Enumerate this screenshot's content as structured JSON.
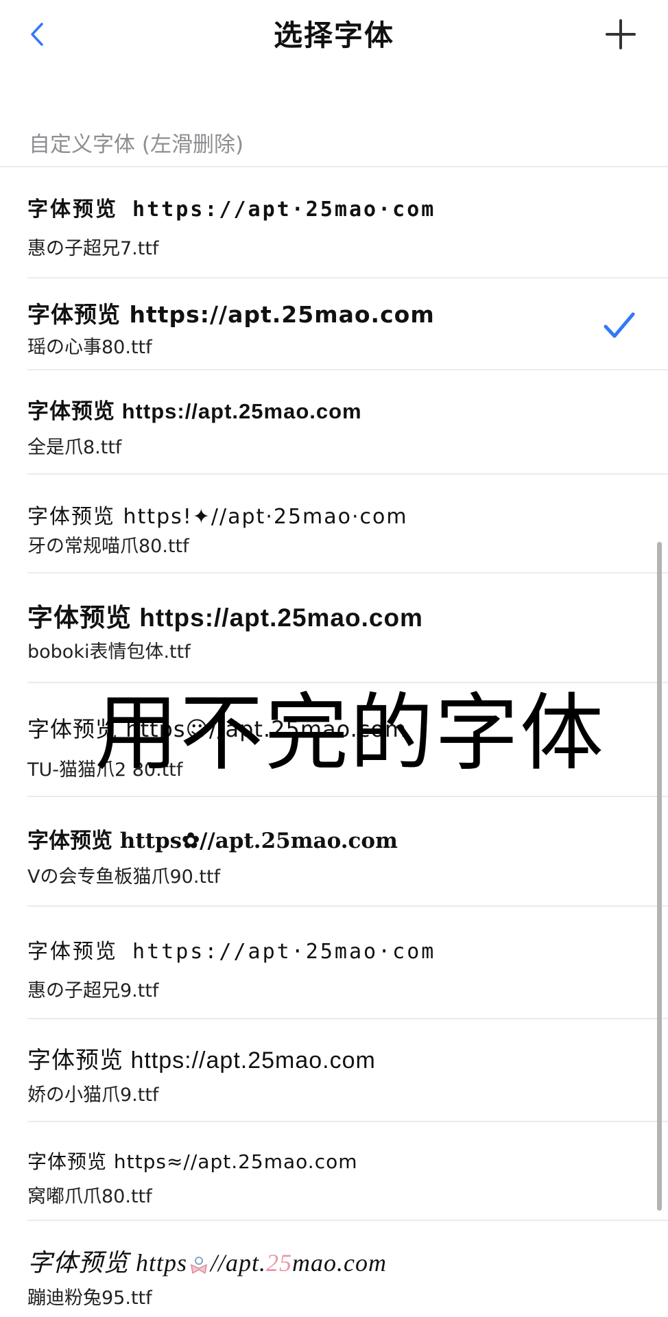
{
  "header": {
    "title": "选择字体",
    "back_icon": "chevron-left-icon",
    "add_icon": "plus-icon",
    "accent_color": "#3478f6"
  },
  "section": {
    "label": "自定义字体 (左滑删除)"
  },
  "fonts": [
    {
      "preview": "字体预览 https://apt·25mao·com",
      "filename": "惠の子超兄7.ttf",
      "selected": false
    },
    {
      "preview": "字体预览 https://apt.25mao.com",
      "filename": "瑶の心事80.ttf",
      "selected": true
    },
    {
      "preview": "字体预览 https://apt.25mao.com",
      "filename": "全是爪8.ttf",
      "selected": false
    },
    {
      "preview": "字体预览 https!✦//apt·25mao·com",
      "filename": "牙の常规喵爪80.ttf",
      "selected": false
    },
    {
      "preview": "字体预览 https://apt.25mao.com",
      "filename": "boboki表情包体.ttf",
      "selected": false
    },
    {
      "preview": "字体预览 https☺//apt.25mao.com",
      "filename": "TU-猫猫爪2 80.ttf",
      "selected": false
    },
    {
      "preview": "字体预览 https✿//apt.25mao.com",
      "filename": "Vの会专鱼板猫爪90.ttf",
      "selected": false
    },
    {
      "preview": "字体预览 https://apt·25mao·com",
      "filename": "惠の子超兄9.ttf",
      "selected": false
    },
    {
      "preview": "字体预览 https://apt.25mao.com",
      "filename": "娇の小猫爪9.ttf",
      "selected": false
    },
    {
      "preview": "字体预览 https≈//apt.25mao.com",
      "filename": "窝嘟爪爪80.ttf",
      "selected": false
    },
    {
      "preview_a": "字体预览 https",
      "preview_b": "//apt.",
      "preview_c": "25",
      "preview_d": "mao.com",
      "bow_icon": "bow-icon",
      "filename": "蹦迪粉兔95.ttf",
      "selected": false,
      "highlight_color": "#e89aa6"
    }
  ],
  "overlay": {
    "text": "用不完的字体"
  }
}
